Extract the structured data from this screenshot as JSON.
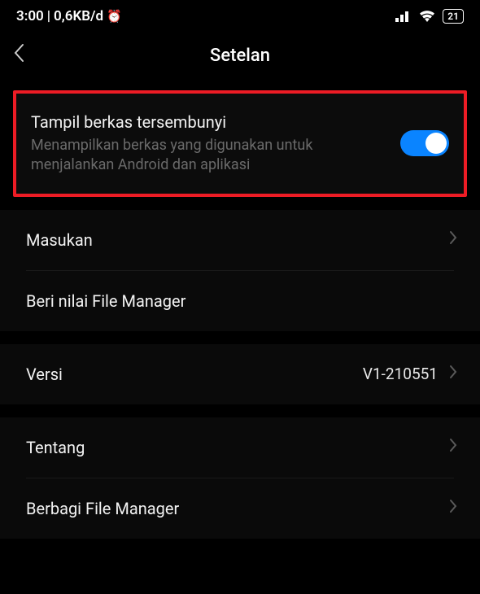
{
  "statusBar": {
    "time": "3:00",
    "dataRate": "0,6KB/d",
    "battery": "21"
  },
  "header": {
    "title": "Setelan"
  },
  "items": {
    "hidden": {
      "title": "Tampil berkas tersembunyi",
      "subtitle": "Menampilkan berkas yang digunakan untuk menjalankan Android dan aplikasi"
    },
    "feedback": {
      "title": "Masukan"
    },
    "rate": {
      "title": "Beri nilai File Manager"
    },
    "version": {
      "title": "Versi",
      "value": "V1-210551"
    },
    "about": {
      "title": "Tentang"
    },
    "share": {
      "title": "Berbagi File Manager"
    }
  }
}
